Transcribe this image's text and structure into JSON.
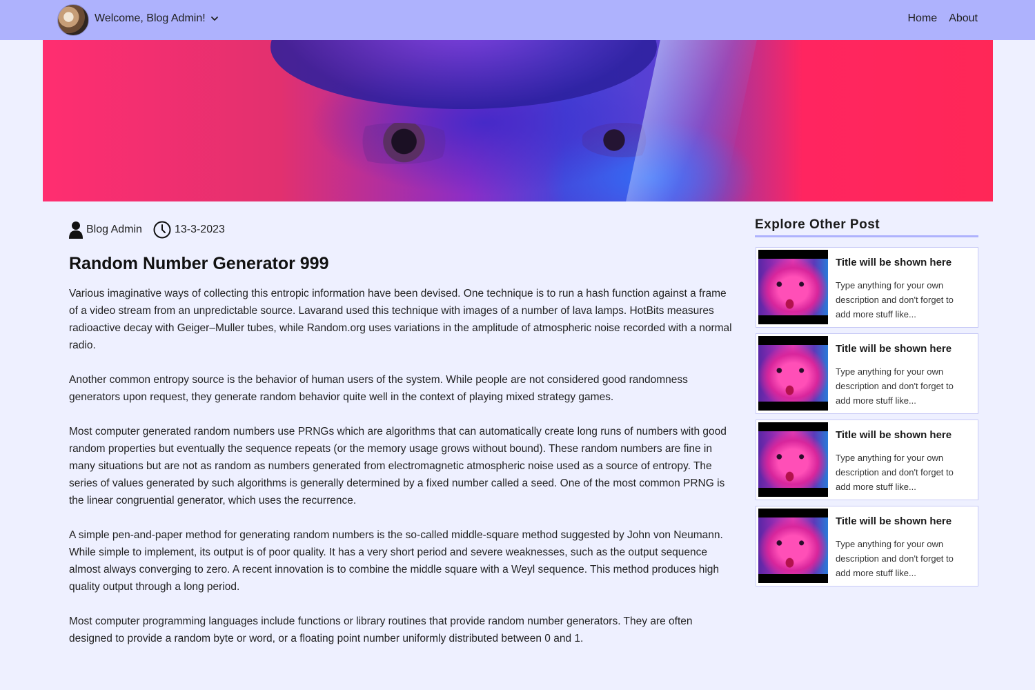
{
  "header": {
    "welcome": "Welcome, Blog Admin!",
    "nav": [
      "Home",
      "About"
    ]
  },
  "post": {
    "author": "Blog Admin",
    "date": "13-3-2023",
    "title": "Random Number Generator 999",
    "paragraphs": [
      "Various imaginative ways of collecting this entropic information have been devised. One technique is to run a hash function against a frame of a video stream from an unpredictable source. Lavarand used this technique with images of a number of lava lamps. HotBits measures radioactive decay with Geiger–Muller tubes, while Random.org uses variations in the amplitude of atmospheric noise recorded with a normal radio.",
      "Another common entropy source is the behavior of human users of the system. While people are not considered good randomness generators upon request, they generate random behavior quite well in the context of playing mixed strategy games.",
      "Most computer generated random numbers use PRNGs which are algorithms that can automatically create long runs of numbers with good random properties but eventually the sequence repeats (or the memory usage grows without bound). These random numbers are fine in many situations but are not as random as numbers generated from electromagnetic atmospheric noise used as a source of entropy. The series of values generated by such algorithms is generally determined by a fixed number called a seed. One of the most common PRNG is the linear congruential generator, which uses the recurrence.",
      "A simple pen-and-paper method for generating random numbers is the so-called middle-square method suggested by John von Neumann. While simple to implement, its output is of poor quality. It has a very short period and severe weaknesses, such as the output sequence almost always converging to zero. A recent innovation is to combine the middle square with a Weyl sequence. This method produces high quality output through a long period.",
      "Most computer programming languages include functions or library routines that provide random number generators. They are often designed to provide a random byte or word, or a floating point number uniformly distributed between 0 and 1."
    ]
  },
  "sidebar": {
    "title": "Explore Other Post",
    "cards": [
      {
        "title": "Title will be shown here",
        "desc": "Type anything for your own description and don't forget to add more stuff like..."
      },
      {
        "title": "Title will be shown here",
        "desc": "Type anything for your own description and don't forget to add more stuff like..."
      },
      {
        "title": "Title will be shown here",
        "desc": "Type anything for your own description and don't forget to add more stuff like..."
      },
      {
        "title": "Title will be shown here",
        "desc": "Type anything for your own description and don't forget to add more stuff like..."
      }
    ]
  },
  "colors": {
    "navbar": "#aeb2fd",
    "page_background": "#eef0ff",
    "accent_rule": "#aeb2fd"
  }
}
